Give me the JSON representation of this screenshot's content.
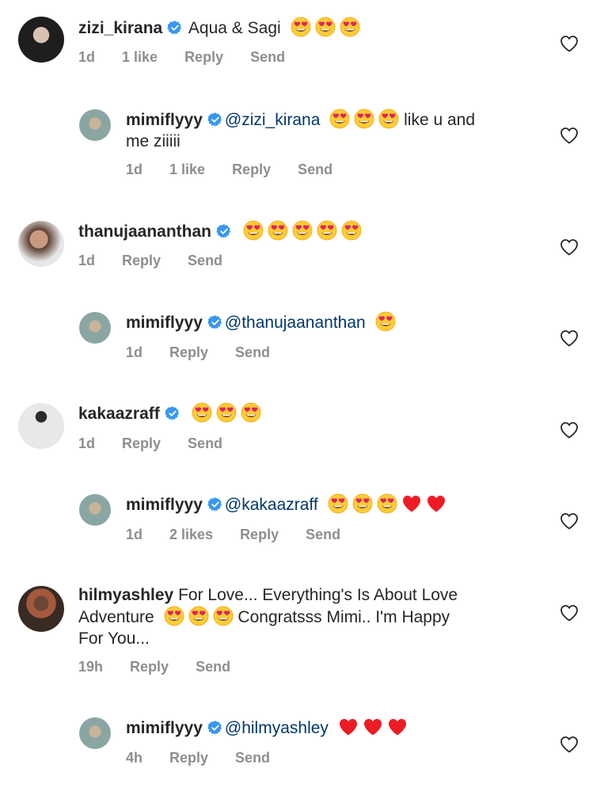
{
  "comments": [
    {
      "username": "zizi_kirana",
      "verified": true,
      "mention": "",
      "text_before": "Aqua & Sagi",
      "emojis": [
        "heart-eyes",
        "heart-eyes",
        "heart-eyes"
      ],
      "text_after": "",
      "text_line2": "",
      "time": "1d",
      "likes": "1 like",
      "reply_label": "Reply",
      "send_label": "Send",
      "avatar_color": "#1e1e1e",
      "is_reply": false
    },
    {
      "username": "mimiflyyy",
      "verified": true,
      "mention": "@zizi_kirana",
      "text_before": "",
      "emojis": [
        "heart-eyes",
        "heart-eyes",
        "heart-eyes"
      ],
      "text_after": "like u and",
      "text_line2": "me ziiiii",
      "time": "1d",
      "likes": "1 like",
      "reply_label": "Reply",
      "send_label": "Send",
      "avatar_color": "#8aa6a3",
      "is_reply": true
    },
    {
      "username": "thanujaananthan",
      "verified": true,
      "mention": "",
      "text_before": "",
      "emojis": [
        "heart-eyes",
        "heart-eyes",
        "heart-eyes",
        "heart-eyes",
        "heart-eyes"
      ],
      "text_after": "",
      "text_line2": "",
      "time": "1d",
      "likes": "",
      "reply_label": "Reply",
      "send_label": "Send",
      "avatar_color": "#6b4a3a",
      "is_reply": false
    },
    {
      "username": "mimiflyyy",
      "verified": true,
      "mention": "@thanujaananthan",
      "text_before": "",
      "emojis": [
        "heart-eyes"
      ],
      "text_after": "",
      "text_line2": "",
      "time": "1d",
      "likes": "",
      "reply_label": "Reply",
      "send_label": "Send",
      "avatar_color": "#8aa6a3",
      "is_reply": true
    },
    {
      "username": "kakaazraff",
      "verified": true,
      "mention": "",
      "text_before": "",
      "emojis": [
        "heart-eyes",
        "heart-eyes",
        "heart-eyes"
      ],
      "text_after": "",
      "text_line2": "",
      "time": "1d",
      "likes": "",
      "reply_label": "Reply",
      "send_label": "Send",
      "avatar_color": "#dcdcdc",
      "is_reply": false
    },
    {
      "username": "mimiflyyy",
      "verified": true,
      "mention": "@kakaazraff",
      "text_before": "",
      "emojis": [
        "heart-eyes",
        "heart-eyes",
        "heart-eyes",
        "red-heart",
        "red-heart"
      ],
      "text_after": "",
      "text_line2": "",
      "time": "1d",
      "likes": "2 likes",
      "reply_label": "Reply",
      "send_label": "Send",
      "avatar_color": "#8aa6a3",
      "is_reply": true
    },
    {
      "username": "hilmyashley",
      "verified": false,
      "mention": "",
      "text_before": "For Love... Everything's Is About Love",
      "text_line2_pre": "Adventure",
      "emojis": [
        "heart-eyes",
        "heart-eyes",
        "heart-eyes"
      ],
      "text_after": "Congratsss Mimi.. I'm Happy",
      "text_line3": "For You...",
      "time": "19h",
      "likes": "",
      "reply_label": "Reply",
      "send_label": "Send",
      "avatar_color": "#5a3b2e",
      "is_reply": false
    },
    {
      "username": "mimiflyyy",
      "verified": true,
      "mention": "@hilmyashley",
      "text_before": "",
      "emojis": [
        "red-heart",
        "red-heart",
        "red-heart"
      ],
      "text_after": "",
      "text_line2": "",
      "time": "4h",
      "likes": "",
      "reply_label": "Reply",
      "send_label": "Send",
      "avatar_color": "#8aa6a3",
      "is_reply": true
    }
  ],
  "colors": {
    "verified_blue": "#3897f0",
    "mention_blue": "#00376b",
    "meta_gray": "#8e8e8e",
    "heart_red": "#ed1c24"
  },
  "icons": {
    "like": "heart-outline-icon",
    "verified": "verified-badge-icon"
  }
}
